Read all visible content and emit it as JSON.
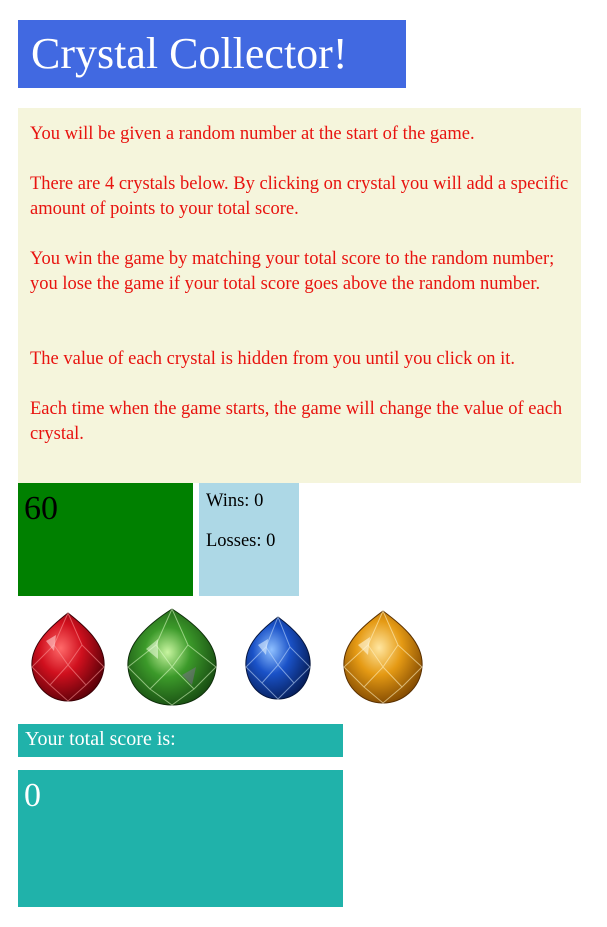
{
  "header": {
    "title": "Crystal Collector!"
  },
  "instructions": {
    "paragraphs": [
      "You will be given a random number at the start of the game.",
      "There are 4 crystals below. By clicking on crystal you will add a specific amount of points to your total score.",
      "You win the game by matching your total score to the random number; you lose the game if your total score goes above the random number.",
      "The value of each crystal is hidden from you until you click on it.",
      "Each time when the game starts, the game will change the value of each crystal."
    ]
  },
  "target": {
    "value": "60"
  },
  "stats": {
    "wins_label": "Wins: 0",
    "losses_label": "Losses: 0"
  },
  "crystals": [
    {
      "icon": "red-crystal-icon",
      "color": "#c8101c"
    },
    {
      "icon": "green-crystal-icon",
      "color": "#2f8a22"
    },
    {
      "icon": "blue-crystal-icon",
      "color": "#1a52c8"
    },
    {
      "icon": "orange-crystal-icon",
      "color": "#e59a14"
    }
  ],
  "score": {
    "label": "Your total score is:",
    "value": "0"
  },
  "colors": {
    "title_bg": "#4169e1",
    "instructions_bg": "#f5f5dc",
    "instructions_text": "#e8130f",
    "target_bg": "#008000",
    "stats_bg": "#add8e6",
    "score_bg": "#20b2aa"
  }
}
